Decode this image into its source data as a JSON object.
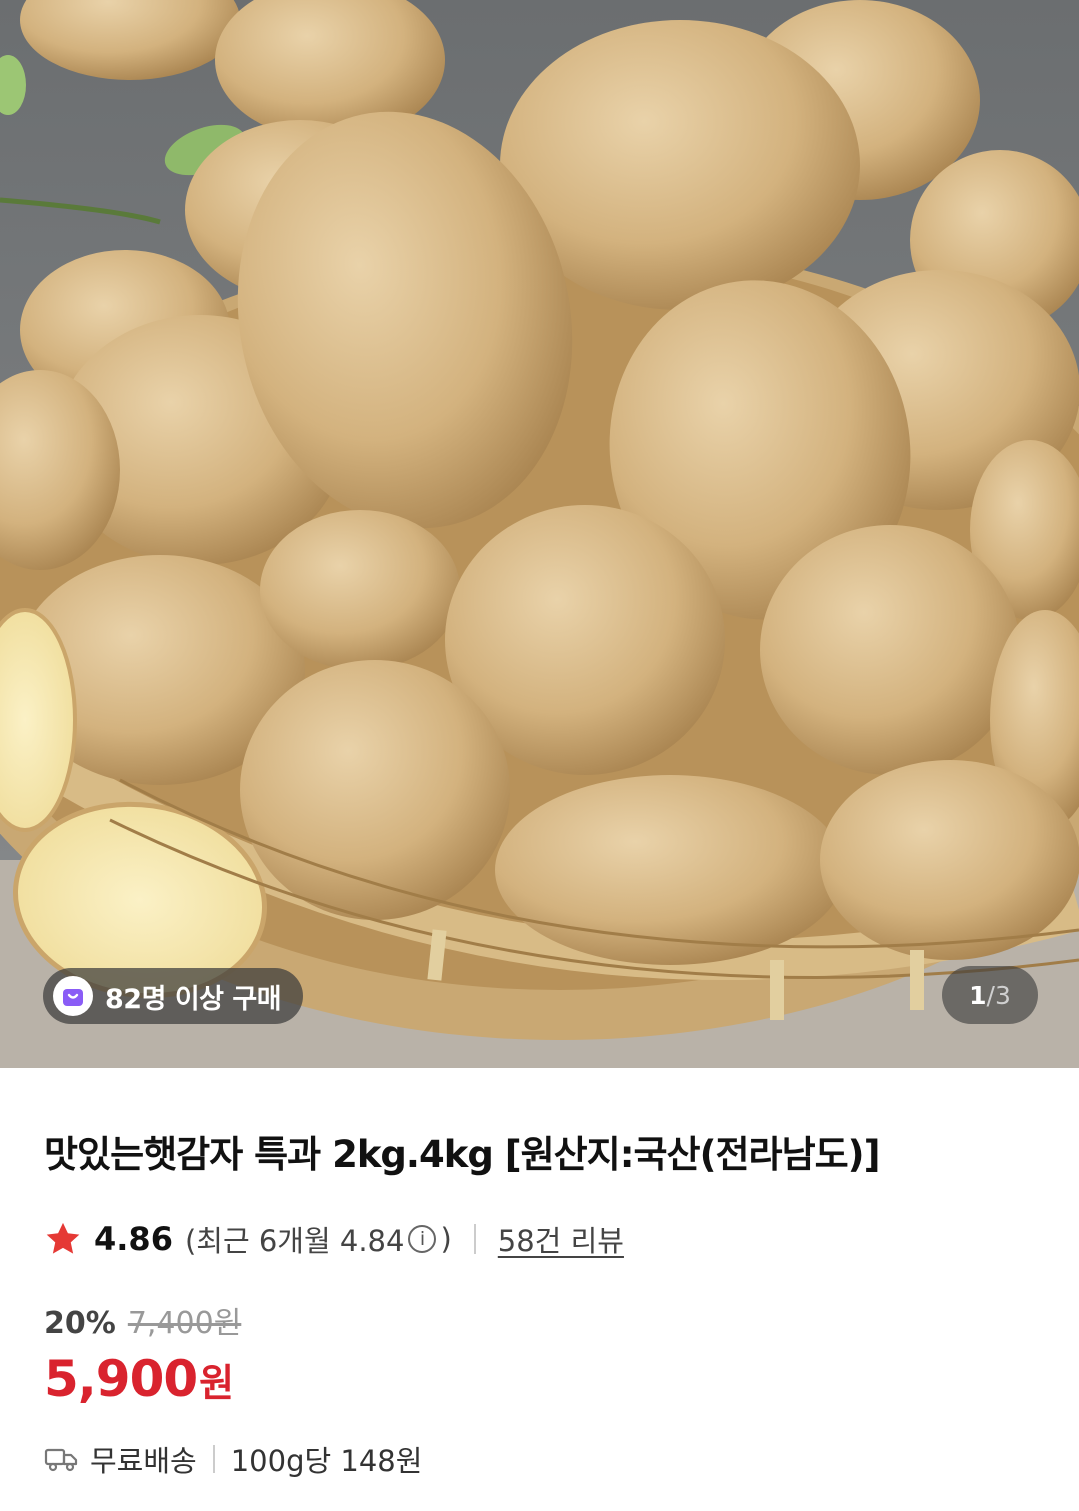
{
  "hero": {
    "purchase_badge": "82명 이상 구매",
    "pager": {
      "current": "1",
      "separator": "/",
      "total": "3"
    }
  },
  "product": {
    "title": "맛있는햇감자 특과 2kg.4kg [원산지:국산(전라남도)]",
    "rating": {
      "score": "4.86",
      "recent_prefix": "(최근 6개월 4.84",
      "recent_suffix": ")",
      "info_symbol": "i",
      "reviews_link": "58건 리뷰"
    },
    "price": {
      "discount_rate": "20%",
      "original": "7,400원",
      "sale_number": "5,900",
      "sale_unit": "원"
    },
    "shipping": {
      "label": "무료배송",
      "unit_price": "100g당 148원"
    }
  },
  "colors": {
    "accent_red": "#d9232e",
    "star": "#e53935",
    "badge_purple": "#8a5cf6"
  },
  "icons": [
    "shopping-bag-icon",
    "star-icon",
    "info-icon",
    "delivery-truck-icon"
  ]
}
